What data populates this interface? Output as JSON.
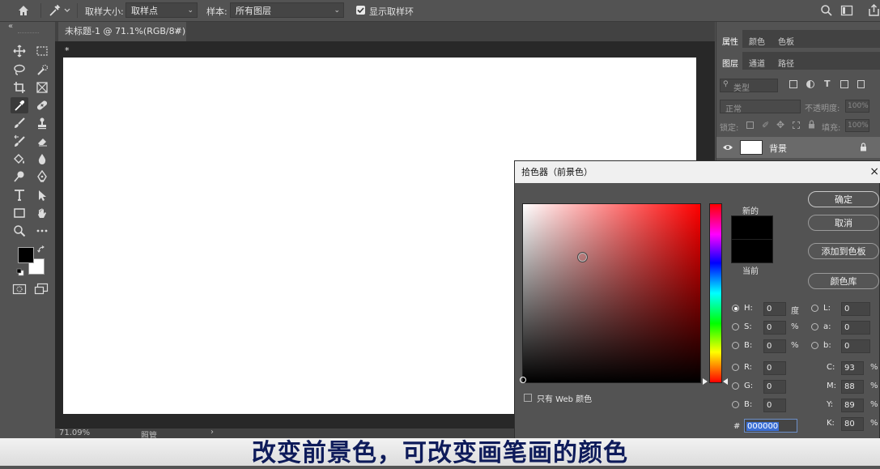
{
  "options_bar": {
    "sample_size_label": "取样大小:",
    "sample_size_value": "取样点",
    "sample_label": "样本:",
    "sample_value": "所有图层",
    "show_ring_label": "显示取样环"
  },
  "document": {
    "tab_title": "未标题-1 @ 71.1%(RGB/8#) *",
    "zoom": "71.09%",
    "status": "照管"
  },
  "right_panel": {
    "tabs_top": [
      "属性",
      "颜色",
      "色板"
    ],
    "tabs_layers": [
      "图层",
      "通道",
      "路径"
    ],
    "kind_label": "类型",
    "blend_mode": "正常",
    "opacity_label": "不透明度:",
    "opacity_value": "100%",
    "lock_label": "锁定:",
    "fill_label": "填充:",
    "fill_value": "100%",
    "layer_name": "背景"
  },
  "color_picker": {
    "title": "拾色器（前景色）",
    "new_label": "新的",
    "current_label": "当前",
    "ok_button": "确定",
    "cancel_button": "取消",
    "add_to_swatches_button": "添加到色板",
    "color_libraries_button": "颜色库",
    "web_only_label": "只有 Web 颜色",
    "hsb": [
      {
        "label": "H:",
        "value": "0",
        "unit": "度"
      },
      {
        "label": "S:",
        "value": "0",
        "unit": "%"
      },
      {
        "label": "B:",
        "value": "0",
        "unit": "%"
      }
    ],
    "rgb": [
      {
        "label": "R:",
        "value": "0"
      },
      {
        "label": "G:",
        "value": "0"
      },
      {
        "label": "B:",
        "value": "0"
      }
    ],
    "lab": [
      {
        "label": "L:",
        "value": "0"
      },
      {
        "label": "a:",
        "value": "0"
      },
      {
        "label": "b:",
        "value": "0"
      }
    ],
    "cmyk": [
      {
        "label": "C:",
        "value": "93",
        "unit": "%"
      },
      {
        "label": "M:",
        "value": "88",
        "unit": "%"
      },
      {
        "label": "Y:",
        "value": "89",
        "unit": "%"
      },
      {
        "label": "K:",
        "value": "80",
        "unit": "%"
      }
    ],
    "hex_label": "#",
    "hex_value": "000000"
  },
  "subtitle": "改变前景色，可改变画笔画的颜色",
  "colors": {
    "foreground": "#000000",
    "background": "#ffffff",
    "hue_selected": "#ff0000"
  }
}
